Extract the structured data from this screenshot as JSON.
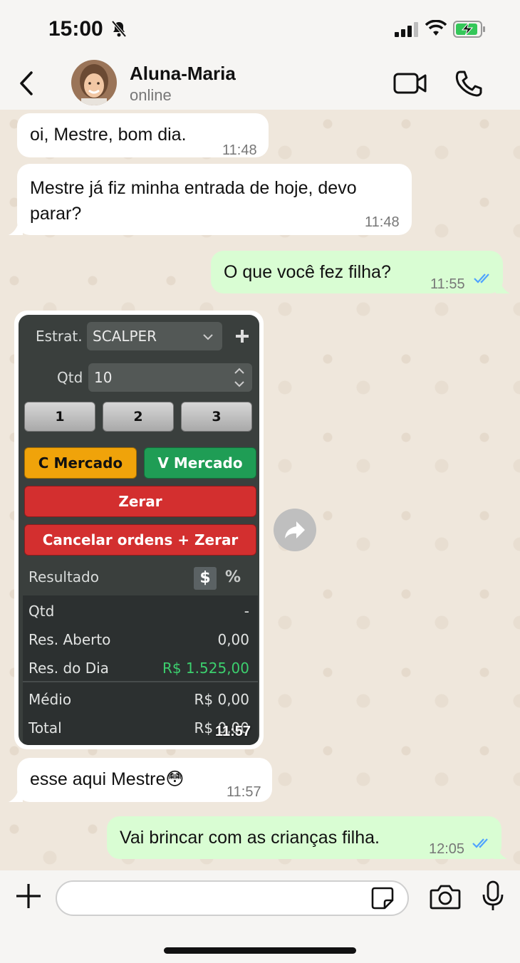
{
  "status_bar": {
    "time": "15:00"
  },
  "header": {
    "name": "Aluna-Maria",
    "status": "online"
  },
  "messages": [
    {
      "type": "in",
      "text": "oi, Mestre, bom dia.",
      "time": "11:48"
    },
    {
      "type": "in",
      "text_line1": "Mestre já fiz minha entrada de hoje, devo",
      "text_line2": "parar?",
      "time": "11:48"
    },
    {
      "type": "out",
      "text": "O que você fez filha?",
      "time": "11:55",
      "read": true
    },
    {
      "type": "image",
      "time": "11:57"
    },
    {
      "type": "in",
      "text": "esse aqui Mestre",
      "emoji": "😳",
      "time": "11:57"
    },
    {
      "type": "out",
      "text": "Vai brincar com as crianças filha.",
      "time": "12:05",
      "read": true
    }
  ],
  "trading_panel": {
    "strategy_label": "Estrat.",
    "strategy_value": "SCALPER",
    "qty_label": "Qtd",
    "qty_value": "10",
    "quick_qty": [
      "1",
      "2",
      "3"
    ],
    "buy_market": "C Mercado",
    "sell_market": "V Mercado",
    "zero": "Zerar",
    "cancel_zero": "Cancelar ordens + Zerar",
    "result_label": "Resultado",
    "currency_toggle": "$",
    "percent_toggle": "%",
    "rows": [
      {
        "label": "Qtd",
        "value": "-"
      },
      {
        "label": "Res. Aberto",
        "value": "0,00"
      },
      {
        "label": "Res. do Dia",
        "value": "R$ 1.525,00"
      },
      {
        "label": "Médio",
        "value": "R$ 0,00"
      },
      {
        "label": "Total",
        "value": "R$ 0,00"
      }
    ],
    "colors": {
      "buy": "#f0a30a",
      "sell": "#1f9d55",
      "zero": "#d32f2f",
      "positive": "#3ccf6e"
    }
  },
  "input": {
    "placeholder": ""
  }
}
